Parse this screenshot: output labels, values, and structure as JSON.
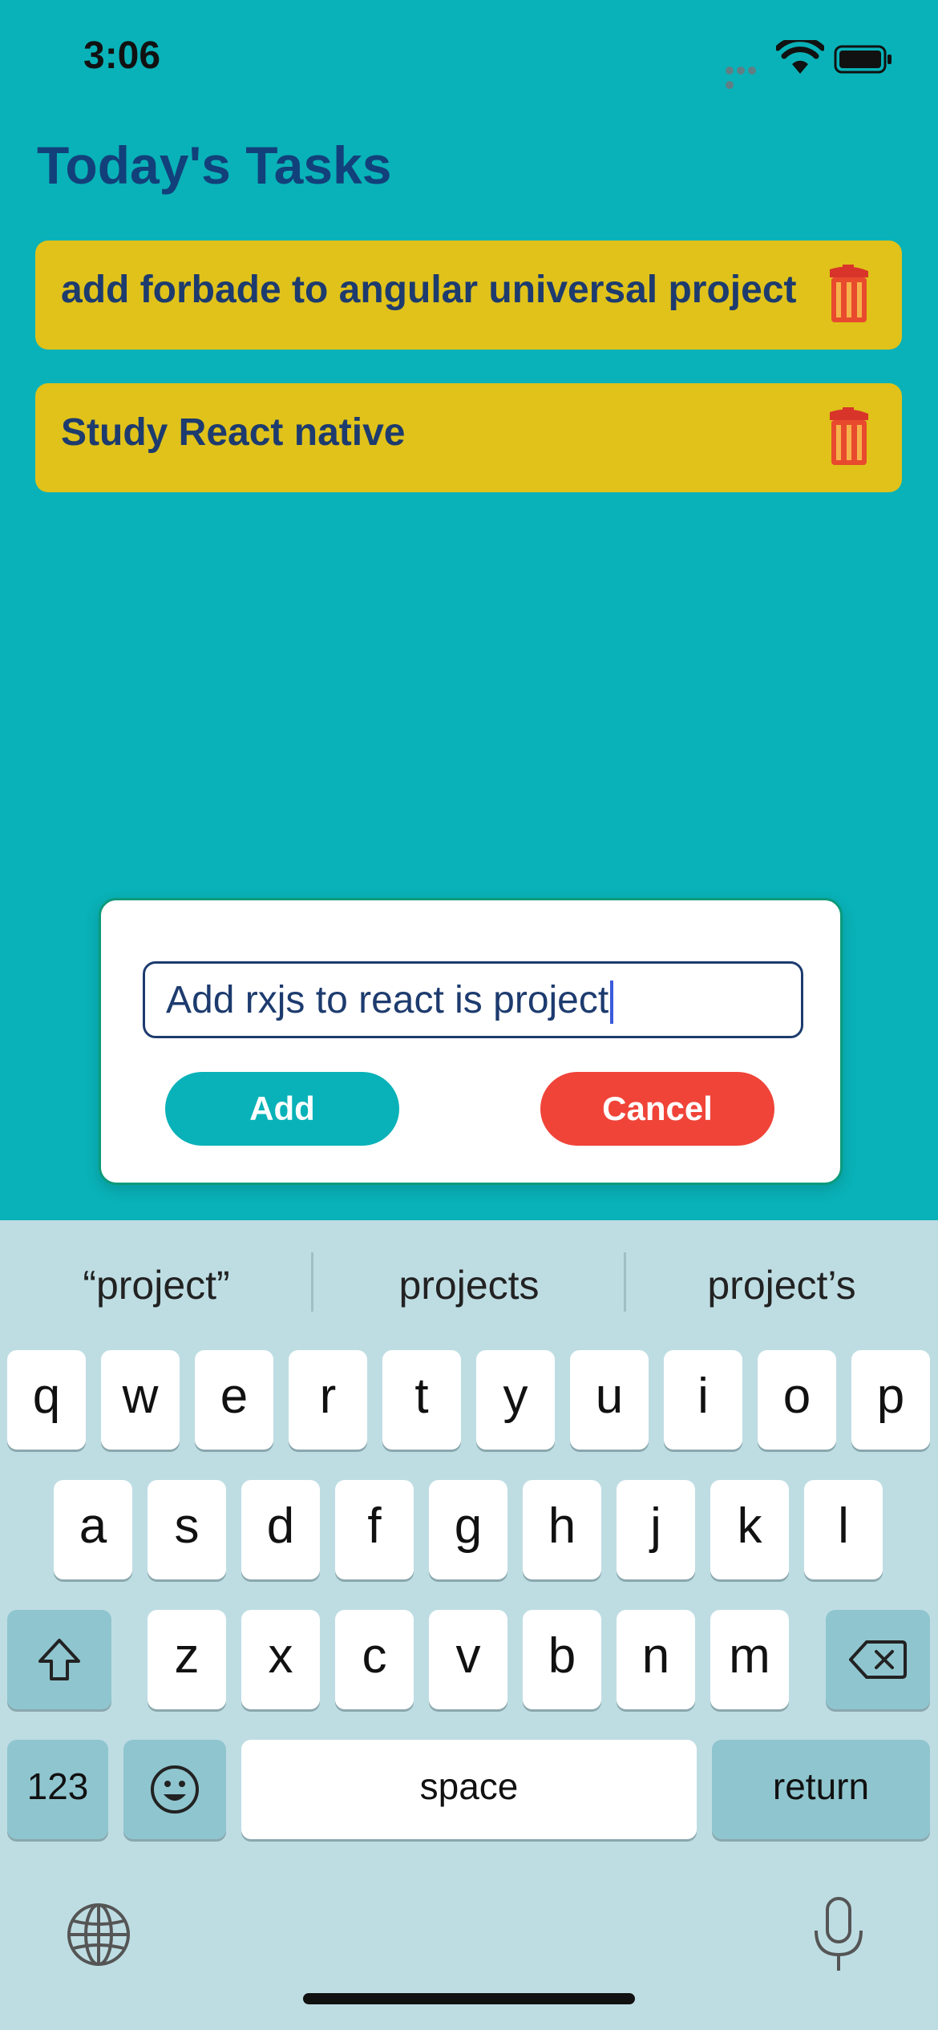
{
  "status_bar": {
    "time": "3:06"
  },
  "header": {
    "title": "Today's Tasks"
  },
  "tasks": [
    {
      "text": "add forbade to angular universal project"
    },
    {
      "text": "Study React native"
    }
  ],
  "modal": {
    "input_value": "Add rxjs to react is project",
    "add_label": "Add",
    "cancel_label": "Cancel"
  },
  "keyboard": {
    "suggestions": [
      "“project”",
      "projects",
      "project’s"
    ],
    "row1": [
      "q",
      "w",
      "e",
      "r",
      "t",
      "y",
      "u",
      "i",
      "o",
      "p"
    ],
    "row2": [
      "a",
      "s",
      "d",
      "f",
      "g",
      "h",
      "j",
      "k",
      "l"
    ],
    "row3": [
      "z",
      "x",
      "c",
      "v",
      "b",
      "n",
      "m"
    ],
    "numbers_label": "123",
    "space_label": "space",
    "return_label": "return"
  },
  "colors": {
    "background": "#09b2b8",
    "task_card": "#e0c21a",
    "title": "#12407a",
    "cancel": "#f04439",
    "keyboard": "#bedde3"
  }
}
